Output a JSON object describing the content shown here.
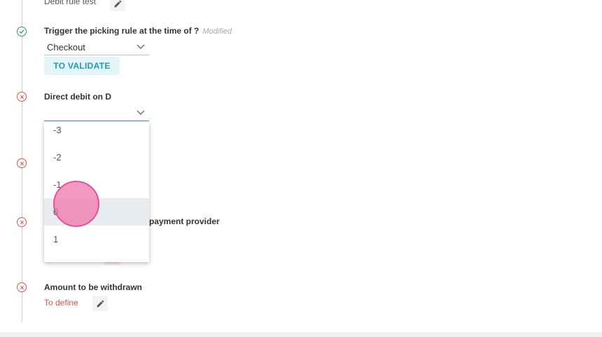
{
  "steps": [
    {
      "status": "done",
      "label": "Debit rule test"
    },
    {
      "status": "done",
      "label": "Trigger the picking rule at the time of ?",
      "badge": "Modified",
      "select_value": "Checkout",
      "button": "TO VALIDATE"
    },
    {
      "status": "error",
      "label": "Direct debit on D",
      "select_value": ""
    },
    {
      "status": "error",
      "label": ""
    },
    {
      "status": "error",
      "label": "payment provider"
    },
    {
      "status": "error",
      "label": "Amount to be withdrawn",
      "value": "To define"
    }
  ],
  "dropdown": {
    "options": [
      "-3",
      "-2",
      "-1",
      "0",
      "1"
    ],
    "hovered_option": "0"
  },
  "icons": {
    "done": "check-circle-icon",
    "error": "x-circle-icon",
    "edit": "pencil-icon",
    "expand": "chevron-down-icon"
  },
  "colors": {
    "success": "#2e9e4f",
    "error": "#d9534f",
    "accent": "#1f9bb0",
    "accent_bg": "#e4f5f7",
    "click_indicator": "#f06eaa"
  }
}
